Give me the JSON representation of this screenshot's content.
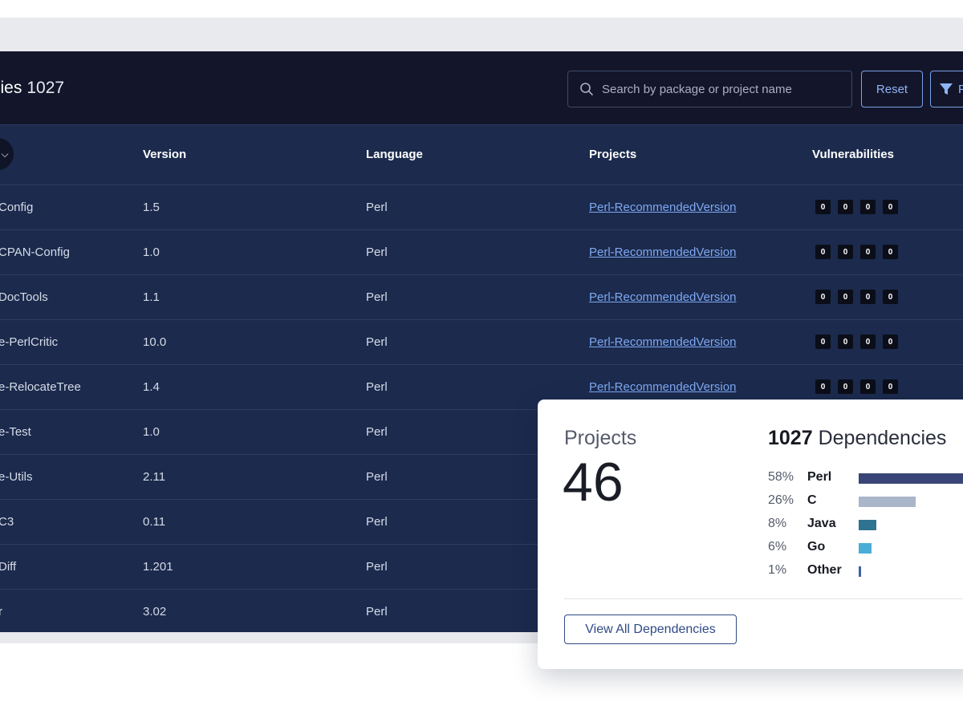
{
  "header": {
    "title_partial": "sies",
    "count": "1027",
    "search_placeholder": "Search by package or project name",
    "reset_label": "Reset",
    "filter_label": "F"
  },
  "columns": {
    "version": "Version",
    "language": "Language",
    "projects": "Projects",
    "vulnerabilities": "Vulnerabilities"
  },
  "rows": [
    {
      "name": "Config",
      "version": "1.5",
      "language": "Perl",
      "project": "Perl-RecommendedVersion",
      "vulns": [
        "0",
        "0",
        "0",
        "0"
      ]
    },
    {
      "name": "CPAN-Config",
      "version": "1.0",
      "language": "Perl",
      "project": "Perl-RecommendedVersion",
      "vulns": [
        "0",
        "0",
        "0",
        "0"
      ]
    },
    {
      "name": "DocTools",
      "version": "1.1",
      "language": "Perl",
      "project": "Perl-RecommendedVersion",
      "vulns": [
        "0",
        "0",
        "0",
        "0"
      ]
    },
    {
      "name": "e-PerlCritic",
      "version": "10.0",
      "language": "Perl",
      "project": "Perl-RecommendedVersion",
      "vulns": [
        "0",
        "0",
        "0",
        "0"
      ]
    },
    {
      "name": "e-RelocateTree",
      "version": "1.4",
      "language": "Perl",
      "project": "Perl-RecommendedVersion",
      "vulns": [
        "0",
        "0",
        "0",
        "0"
      ]
    },
    {
      "name": "e-Test",
      "version": "1.0",
      "language": "Perl",
      "project": "",
      "vulns": []
    },
    {
      "name": "e-Utils",
      "version": "2.11",
      "language": "Perl",
      "project": "",
      "vulns": []
    },
    {
      "name": "C3",
      "version": "0.11",
      "language": "Perl",
      "project": "",
      "vulns": []
    },
    {
      "name": "Diff",
      "version": "1.201",
      "language": "Perl",
      "project": "",
      "vulns": []
    },
    {
      "name": "r",
      "version": "3.02",
      "language": "Perl",
      "project": "",
      "vulns": []
    }
  ],
  "summary": {
    "projects_label": "Projects",
    "projects_count": "46",
    "deps_count": "1027",
    "deps_label": "Dependencies",
    "breakdown": [
      {
        "pct": "58%",
        "name": "Perl",
        "fraction": 0.58,
        "color": "#3a4577"
      },
      {
        "pct": "26%",
        "name": "C",
        "fraction": 0.26,
        "color": "#aab6c9"
      },
      {
        "pct": "8%",
        "name": "Java",
        "fraction": 0.08,
        "color": "#2f7391"
      },
      {
        "pct": "6%",
        "name": "Go",
        "fraction": 0.06,
        "color": "#49add6"
      },
      {
        "pct": "1%",
        "name": "Other",
        "fraction": 0.01,
        "color": "#3f5fa8"
      }
    ],
    "view_all_label": "View All Dependencies"
  }
}
